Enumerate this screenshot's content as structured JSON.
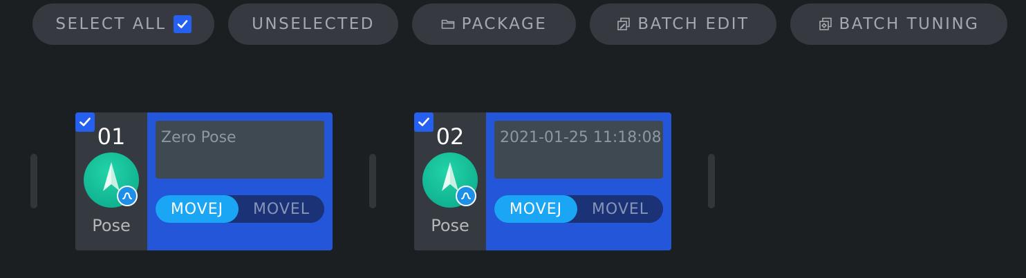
{
  "toolbar": {
    "select_all": {
      "label": "SELECT ALL",
      "checked": true
    },
    "unselected": {
      "label": "UNSELECTED"
    },
    "package": {
      "label": "PACKAGE",
      "icon": "folder-icon"
    },
    "batch_edit": {
      "label": "BATCH EDIT",
      "icon": "edit-copy-icon"
    },
    "batch_tuning": {
      "label": "BATCH TUNING",
      "icon": "tuning-copy-icon"
    }
  },
  "colors": {
    "background": "#1c1f22",
    "button_bg": "#363a40",
    "card_bg": "#2356d8",
    "checkbox": "#2660f0",
    "movej_active": "#1aa6f5",
    "avatar": "#0aa688"
  },
  "cards": [
    {
      "number": "01",
      "type_label": "Pose",
      "name": "Zero Pose",
      "checked": true,
      "modes": [
        "MOVEJ",
        "MOVEL"
      ],
      "active_mode": "MOVEJ"
    },
    {
      "number": "02",
      "type_label": "Pose",
      "name": "2021-01-25 11:18:08",
      "checked": true,
      "modes": [
        "MOVEJ",
        "MOVEL"
      ],
      "active_mode": "MOVEJ"
    }
  ]
}
